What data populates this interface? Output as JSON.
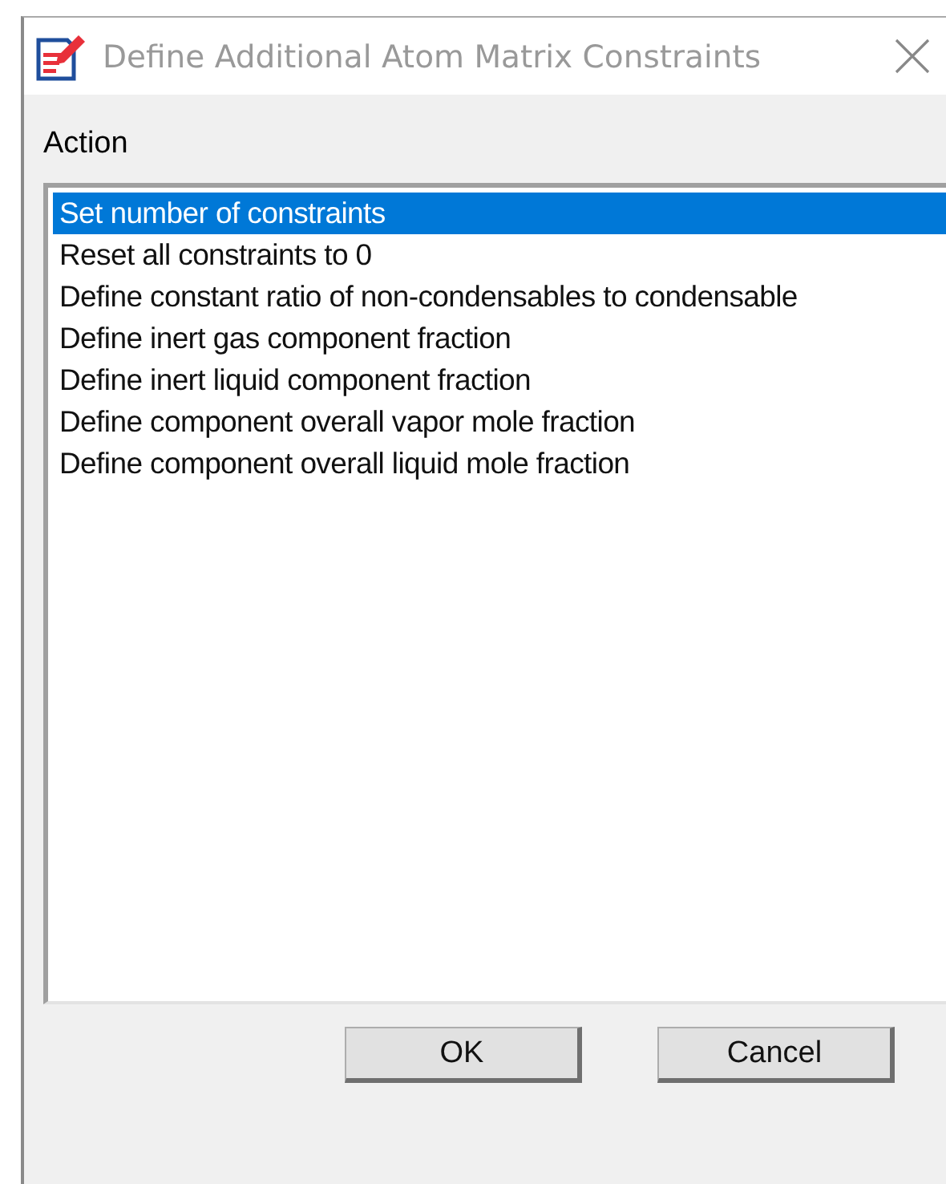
{
  "window": {
    "title": "Define Additional Atom Matrix Constraints"
  },
  "action": {
    "label": "Action",
    "items": [
      {
        "text": "Set number of constraints",
        "selected": true
      },
      {
        "text": "Reset all constraints to 0",
        "selected": false
      },
      {
        "text": "Define constant ratio of non-condensables to condensable",
        "selected": false
      },
      {
        "text": "Define inert gas component fraction",
        "selected": false
      },
      {
        "text": "Define inert liquid component fraction",
        "selected": false
      },
      {
        "text": "Define component overall vapor mole fraction",
        "selected": false
      },
      {
        "text": "Define component overall liquid mole fraction",
        "selected": false
      }
    ]
  },
  "buttons": [
    "OK",
    "Cancel"
  ]
}
